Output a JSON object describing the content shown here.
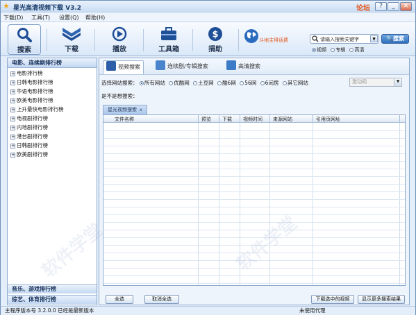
{
  "app": {
    "title": "星光高清视频下载 V3.2",
    "forum_link": "论坛",
    "window_buttons": [
      "?",
      "_",
      "□",
      "✕"
    ]
  },
  "menu": [
    "下载(D)",
    "工具(T)",
    "设置(Q)",
    "帮助(H)"
  ],
  "toolbar": {
    "items": [
      "搜索",
      "下载",
      "播放",
      "工具箱",
      "捐助"
    ],
    "active": "搜索",
    "extra_label": "斗地主得话费"
  },
  "search": {
    "placeholder": "请输入搜索关键字",
    "button": "搜索",
    "types": [
      "视频",
      "专辑",
      "高清"
    ],
    "selected_type": "视频"
  },
  "sidebar": {
    "header": "电影、连续剧排行榜",
    "items": [
      "电影排行榜",
      "日韩电影排行榜",
      "华语电影排行榜",
      "欧美电影排行榜",
      "上升最快电影排行榜",
      "电视剧排行榜",
      "内地剧排行榜",
      "港台剧排行榜",
      "日韩剧排行榜",
      "欧美剧排行榜"
    ],
    "footers": [
      "音乐、游戏排行榜",
      "综艺、体育排行榜"
    ]
  },
  "main": {
    "tabs": [
      "视频搜索",
      "连续剧/专辑搜索",
      "高清搜索"
    ],
    "active_tab": "视频搜索",
    "site_label": "选择网站搜索：",
    "sites": [
      "所有网站",
      "优酷网",
      "土豆网",
      "酷6网",
      "56网",
      "6间房",
      "其它网站"
    ],
    "selected_site": "所有网站",
    "site_dropdown": "激动网",
    "want_label": "是不是想搜索：",
    "result_tab": "星光视频搜索",
    "result_tab_close": "x",
    "columns": [
      "文件名称",
      "预览",
      "下载",
      "视频时间",
      "来源网站",
      "引用页网址"
    ],
    "buttons": {
      "select_all": "全选",
      "deselect_all": "取消全选",
      "download_selected": "下载选中的视频",
      "show_more": "显示更多搜索结果"
    }
  },
  "status": {
    "version": "主程序版本号 3.2.0.0  已经是最新版本",
    "proxy": "未使用代理"
  },
  "watermark": "软件学堂",
  "colors": {
    "accent": "#2f6fbd",
    "forum": "#e24d10"
  }
}
